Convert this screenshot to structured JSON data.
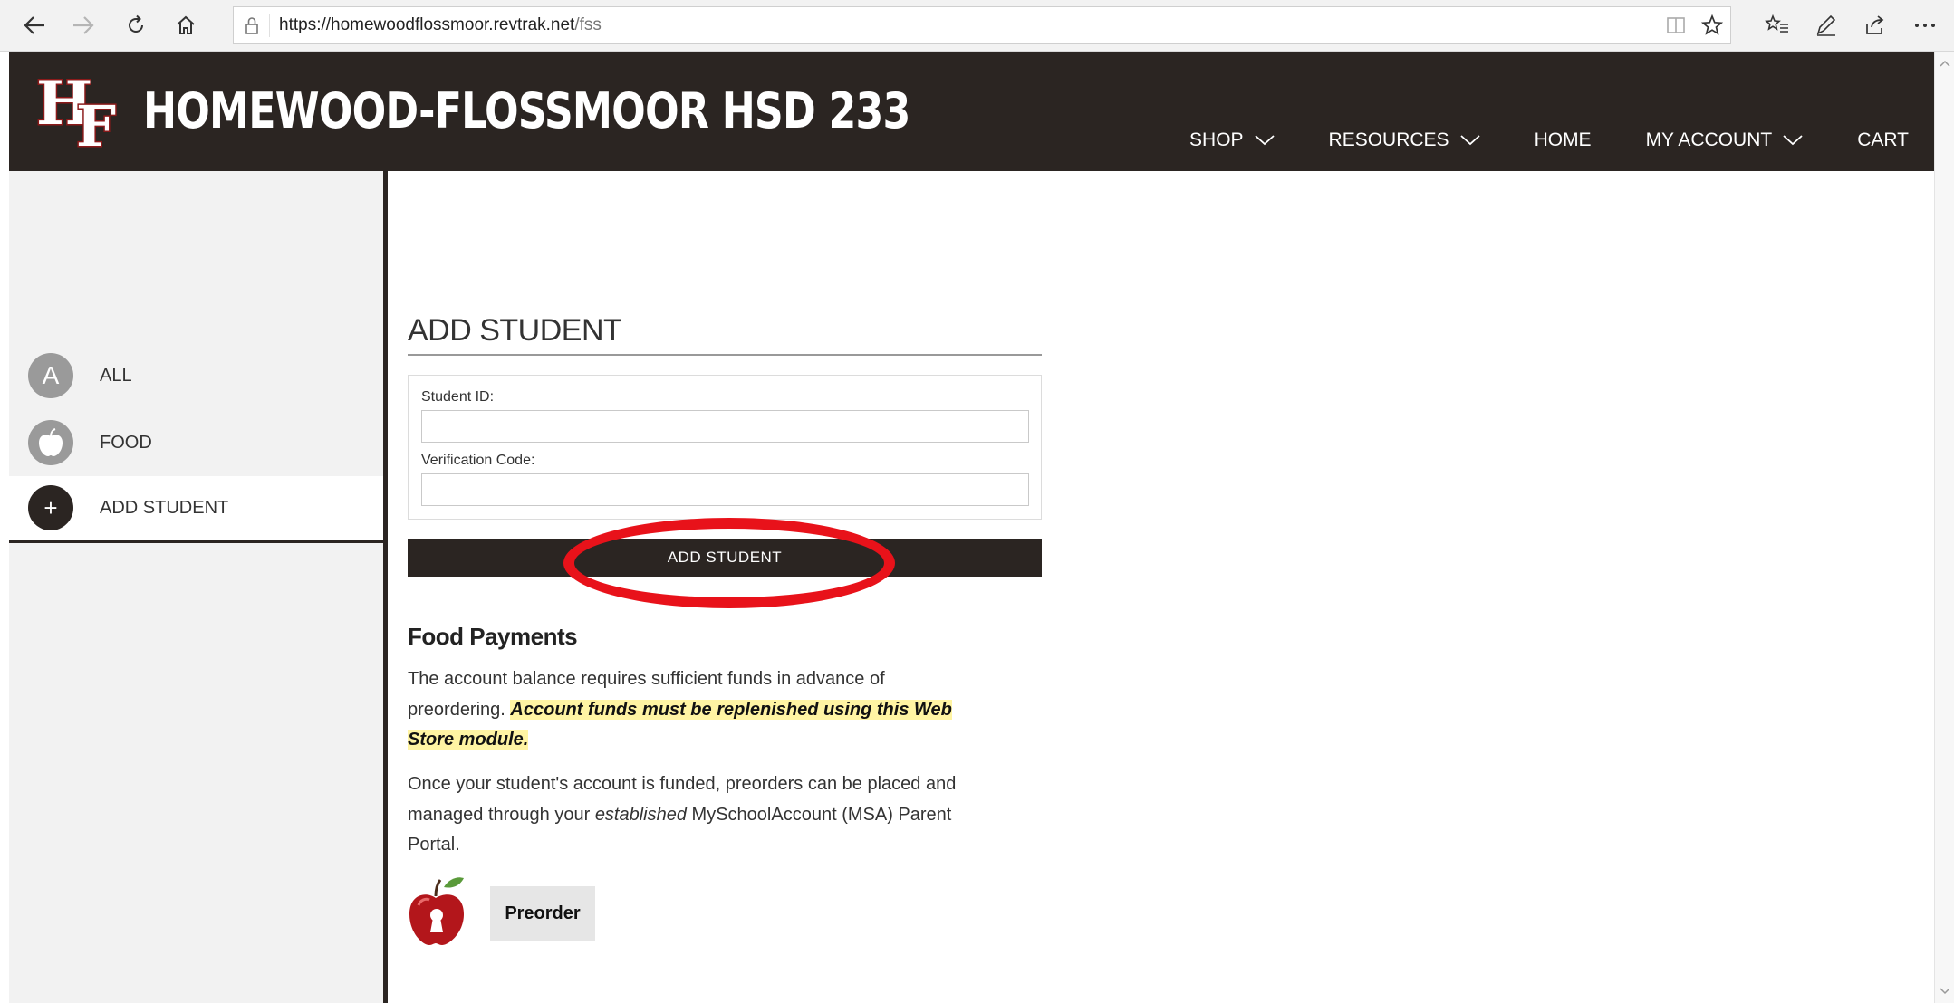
{
  "browser": {
    "url_host": "https://homewoodflossmoor.revtrak.net",
    "url_path": "/fss"
  },
  "header": {
    "logo_text": "HF",
    "title": "HOMEWOOD-FLOSSMOOR HSD 233",
    "nav": [
      {
        "label": "SHOP",
        "dropdown": true
      },
      {
        "label": "RESOURCES",
        "dropdown": true
      },
      {
        "label": "HOME",
        "dropdown": false
      },
      {
        "label": "MY ACCOUNT",
        "dropdown": true
      },
      {
        "label": "CART",
        "dropdown": false
      }
    ]
  },
  "sidebar": {
    "items": [
      {
        "label": "ALL",
        "icon_char": "A",
        "icon": "letter-a-icon",
        "color": "#9a9a9a",
        "active": false
      },
      {
        "label": "FOOD",
        "icon_char": "",
        "icon": "apple-icon",
        "color": "#9a9a9a",
        "active": false
      },
      {
        "label": "ADD STUDENT",
        "icon_char": "+",
        "icon": "plus-icon",
        "color": "#2b2522",
        "active": true
      }
    ]
  },
  "main": {
    "title": "ADD STUDENT",
    "student_id_label": "Student ID:",
    "student_id_value": "",
    "verification_label": "Verification Code:",
    "verification_value": "",
    "add_button": "ADD STUDENT",
    "food_heading": "Food Payments",
    "para1_plain": "The account balance requires sufficient funds in advance of preordering. ",
    "para1_highlight": "Account funds must be replenished using this Web Store module.",
    "para2_a": "Once your student's account is funded, preorders can be placed and managed through your ",
    "para2_em": "established",
    "para2_b": " MySchoolAccount (MSA) Parent Portal.",
    "preorder_button": "Preorder"
  },
  "colors": {
    "brand_dark": "#2b2522",
    "highlight_ring": "#e8121a",
    "highlight_text_bg": "#fff4a3"
  }
}
